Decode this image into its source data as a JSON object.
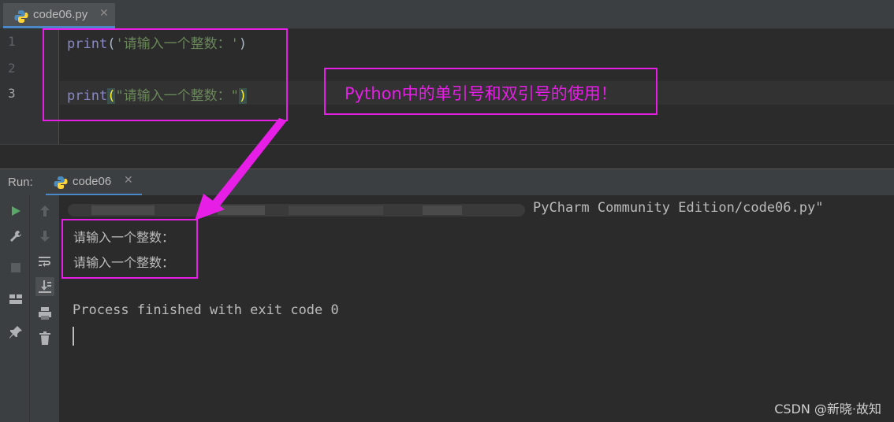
{
  "tab": {
    "filename": "code06.py",
    "close": "✕"
  },
  "editor": {
    "lines": [
      {
        "number": "1",
        "func": "print",
        "open": "(",
        "string": "'请输入一个整数：'",
        "close": ")"
      },
      {
        "number": "2"
      },
      {
        "number": "3",
        "func": "print",
        "open": "(",
        "string": "\"请输入一个整数：\"",
        "close": ")"
      }
    ]
  },
  "annotation": {
    "label": "Python中的单引号和双引号的使用！",
    "color": "#e61ee6"
  },
  "run": {
    "label": "Run:",
    "tab_label": "code06",
    "close": "✕",
    "command_visible": "PyCharm Community Edition/code06.py\"",
    "output_lines": [
      "请输入一个整数：",
      "请输入一个整数："
    ],
    "finish": "Process finished with exit code 0"
  },
  "tools": {
    "left": [
      "run-icon",
      "wrench-icon",
      "stop-icon",
      "layout-icon",
      "pin-icon"
    ],
    "right": [
      "up-arrow-icon",
      "down-arrow-icon",
      "soft-wrap-icon",
      "scroll-to-end-icon",
      "print-icon",
      "trash-icon"
    ]
  },
  "watermark": "CSDN @新晓·故知",
  "colors": {
    "keyword": "#8888c6",
    "string": "#6a8759",
    "accent": "#4a88c7",
    "highlight": "#e61ee6"
  }
}
